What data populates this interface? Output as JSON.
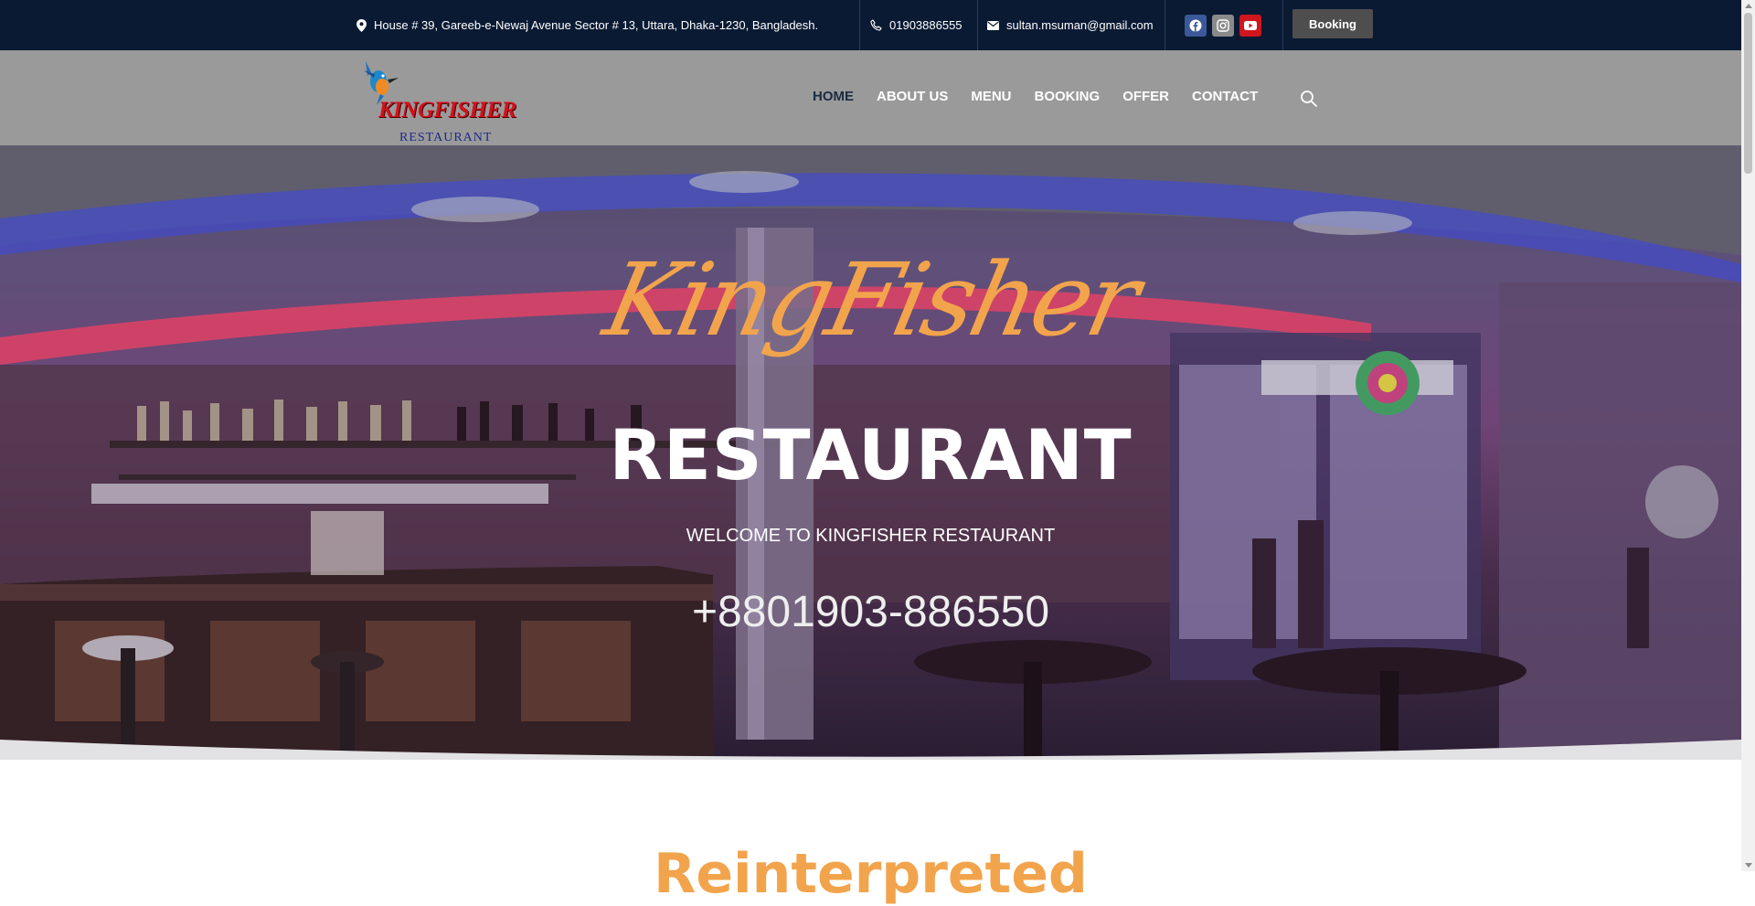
{
  "topbar": {
    "address": "House # 39, Gareeb-e-Newaj Avenue Sector # 13, Uttara, Dhaka-1230, Bangladesh.",
    "phone": "01903886555",
    "email": "sultan.msuman@gmail.com",
    "social": [
      "facebook-icon",
      "instagram-icon",
      "youtube-icon"
    ],
    "booking_label": "Booking"
  },
  "logo": {
    "name": "KINGFISHER",
    "sub": "RESTAURANT"
  },
  "nav": {
    "items": [
      {
        "label": "HOME"
      },
      {
        "label": "ABOUT US"
      },
      {
        "label": "MENU"
      },
      {
        "label": "BOOKING"
      },
      {
        "label": "OFFER"
      },
      {
        "label": "CONTACT"
      }
    ],
    "search_icon": "search-icon"
  },
  "hero": {
    "script_title": "KingFisher",
    "title": "RESTAURANT",
    "subtitle": "WELCOME TO KINGFISHER RESTAURANT",
    "phone": "+8801903-886550"
  },
  "section": {
    "title": "Reinterpreted"
  },
  "colors": {
    "topbar_bg": "#0a1a33",
    "nav_bg": "#9a9a9a",
    "accent": "#f2a44c",
    "nav_active": "#1c2b44",
    "logo_red": "#d4111b",
    "logo_blue": "#1d2a88"
  }
}
